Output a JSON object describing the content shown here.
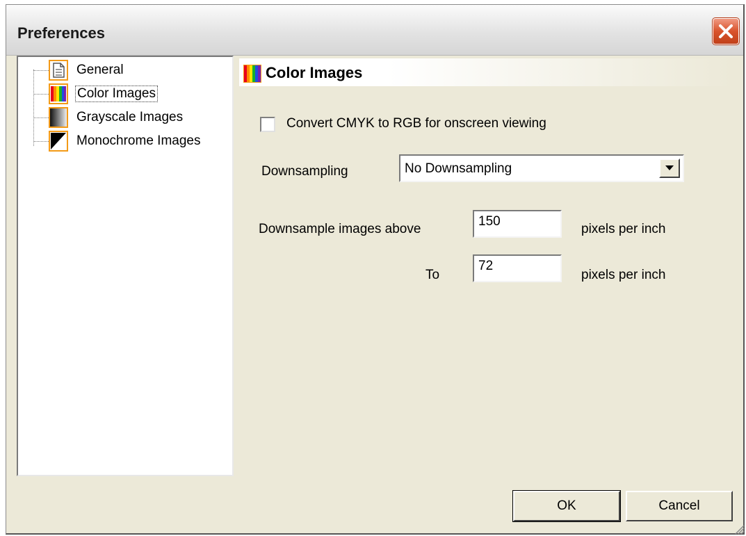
{
  "window": {
    "title": "Preferences"
  },
  "tree": {
    "items": [
      {
        "label": "General",
        "icon": "document-icon"
      },
      {
        "label": "Color Images",
        "icon": "color-bars-icon",
        "selected": true
      },
      {
        "label": "Grayscale Images",
        "icon": "grayscale-gradient-icon"
      },
      {
        "label": "Monochrome Images",
        "icon": "monochrome-triangle-icon"
      }
    ]
  },
  "panel": {
    "title": "Color Images",
    "convert_checkbox": {
      "label": "Convert CMYK to RGB for onscreen viewing",
      "checked": false
    },
    "downsampling": {
      "label": "Downsampling",
      "value": "No Downsampling"
    },
    "downsample_above": {
      "label": "Downsample images above",
      "value": "150",
      "unit": "pixels per inch"
    },
    "downsample_to": {
      "label": "To",
      "value": "72",
      "unit": "pixels per inch"
    }
  },
  "buttons": {
    "ok": "OK",
    "cancel": "Cancel"
  },
  "colors": {
    "accent": "#f39a17",
    "face": "#ece9d8",
    "close": "#d9532c"
  }
}
